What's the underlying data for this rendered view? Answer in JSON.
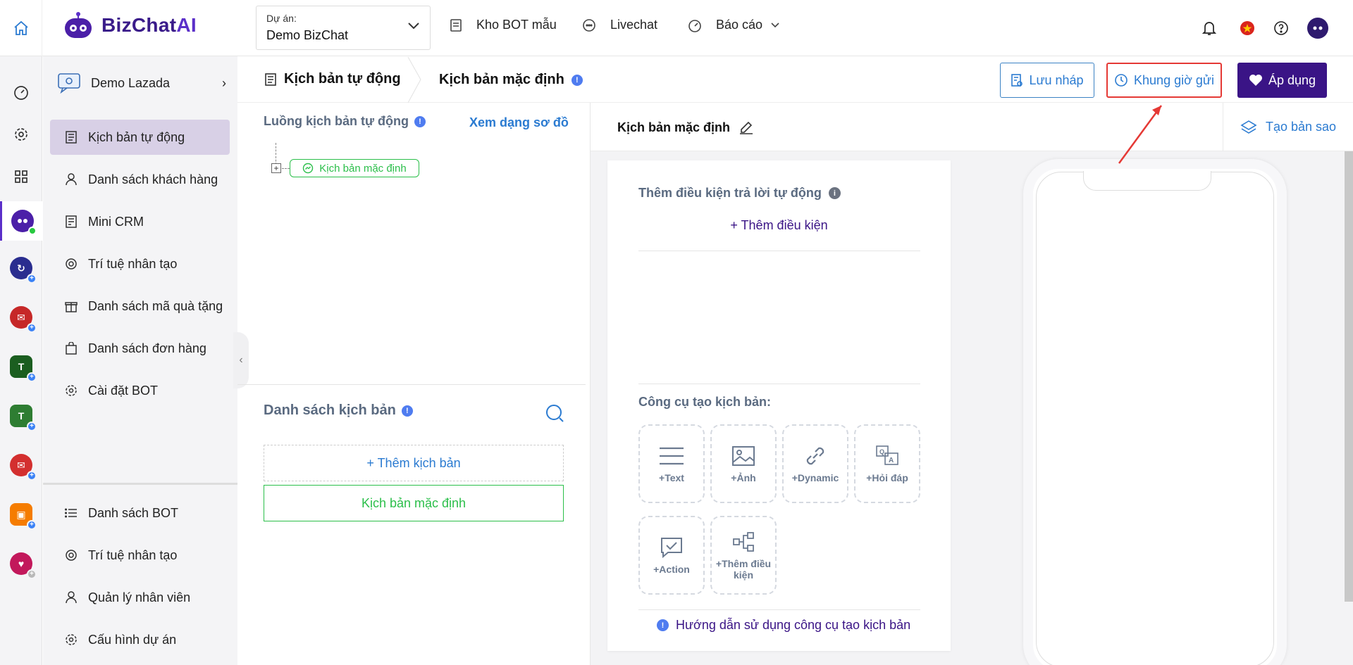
{
  "colors": {
    "accent": "#3a1486",
    "link": "#2b7bd1",
    "success": "#2bbf4a",
    "highlight": "#e53935"
  },
  "header": {
    "logo_main": "BizChat",
    "logo_ai": "AI",
    "project_label": "Dự án:",
    "project_value": "Demo BizChat",
    "nav": [
      {
        "label": "Kho BOT mẫu",
        "icon": "template-icon"
      },
      {
        "label": "Livechat",
        "icon": "chat-icon"
      },
      {
        "label": "Báo cáo",
        "icon": "dashboard-icon"
      }
    ]
  },
  "rail": {
    "items": [
      "dashboard-icon",
      "settings-icon",
      "apps-grid-icon",
      "bizchat-app-icon",
      "app-icon-blue",
      "app-icon-mail",
      "app-icon-green",
      "app-icon-green-2",
      "app-icon-mail-2",
      "app-icon-orange",
      "app-icon-pink"
    ]
  },
  "sidebar": {
    "bot_name": "Demo Lazada",
    "menu": [
      {
        "label": "Kịch bản tự động",
        "icon": "script-icon",
        "active": true
      },
      {
        "label": "Danh sách khách hàng",
        "icon": "user-icon"
      },
      {
        "label": "Mini CRM",
        "icon": "crm-icon"
      },
      {
        "label": "Trí tuệ nhân tạo",
        "icon": "ai-icon"
      },
      {
        "label": "Danh sách mã quà tặng",
        "icon": "gift-icon"
      },
      {
        "label": "Danh sách đơn hàng",
        "icon": "bag-icon"
      },
      {
        "label": "Cài đặt BOT",
        "icon": "gear-icon"
      }
    ],
    "bottom_menu": [
      {
        "label": "Danh sách BOT",
        "icon": "list-icon"
      },
      {
        "label": "Trí tuệ nhân tạo",
        "icon": "ai-icon"
      },
      {
        "label": "Quản lý nhân viên",
        "icon": "user-icon"
      },
      {
        "label": "Cấu hình dự án",
        "icon": "gear-icon"
      }
    ]
  },
  "breadcrumb": {
    "section": "Kịch bản tự động",
    "current": "Kịch bản mặc định"
  },
  "actions": {
    "draft": "Lưu nháp",
    "schedule": "Khung giờ gửi",
    "apply": "Áp dụng"
  },
  "flow": {
    "title": "Luồng kịch bản tự động",
    "diagram_link": "Xem dạng sơ đồ",
    "node": "Kịch bản mặc định"
  },
  "script_list": {
    "title": "Danh sách kịch bản",
    "add": "+ Thêm kịch bản",
    "items": [
      "Kịch bản mặc định"
    ]
  },
  "editor": {
    "title": "Kịch bản mặc định",
    "copy": "Tạo bản sao",
    "cond_title": "Thêm điều kiện trả lời tự động",
    "add_cond": "+ Thêm điều kiện",
    "tools_title": "Công cụ tạo kịch bản:",
    "tools": [
      "+Text",
      "+Ảnh",
      "+Dynamic",
      "+Hỏi đáp",
      "+Action",
      "+Thêm điều kiện"
    ],
    "guide": "Hướng dẫn sử dụng công cụ tạo kịch bản"
  }
}
